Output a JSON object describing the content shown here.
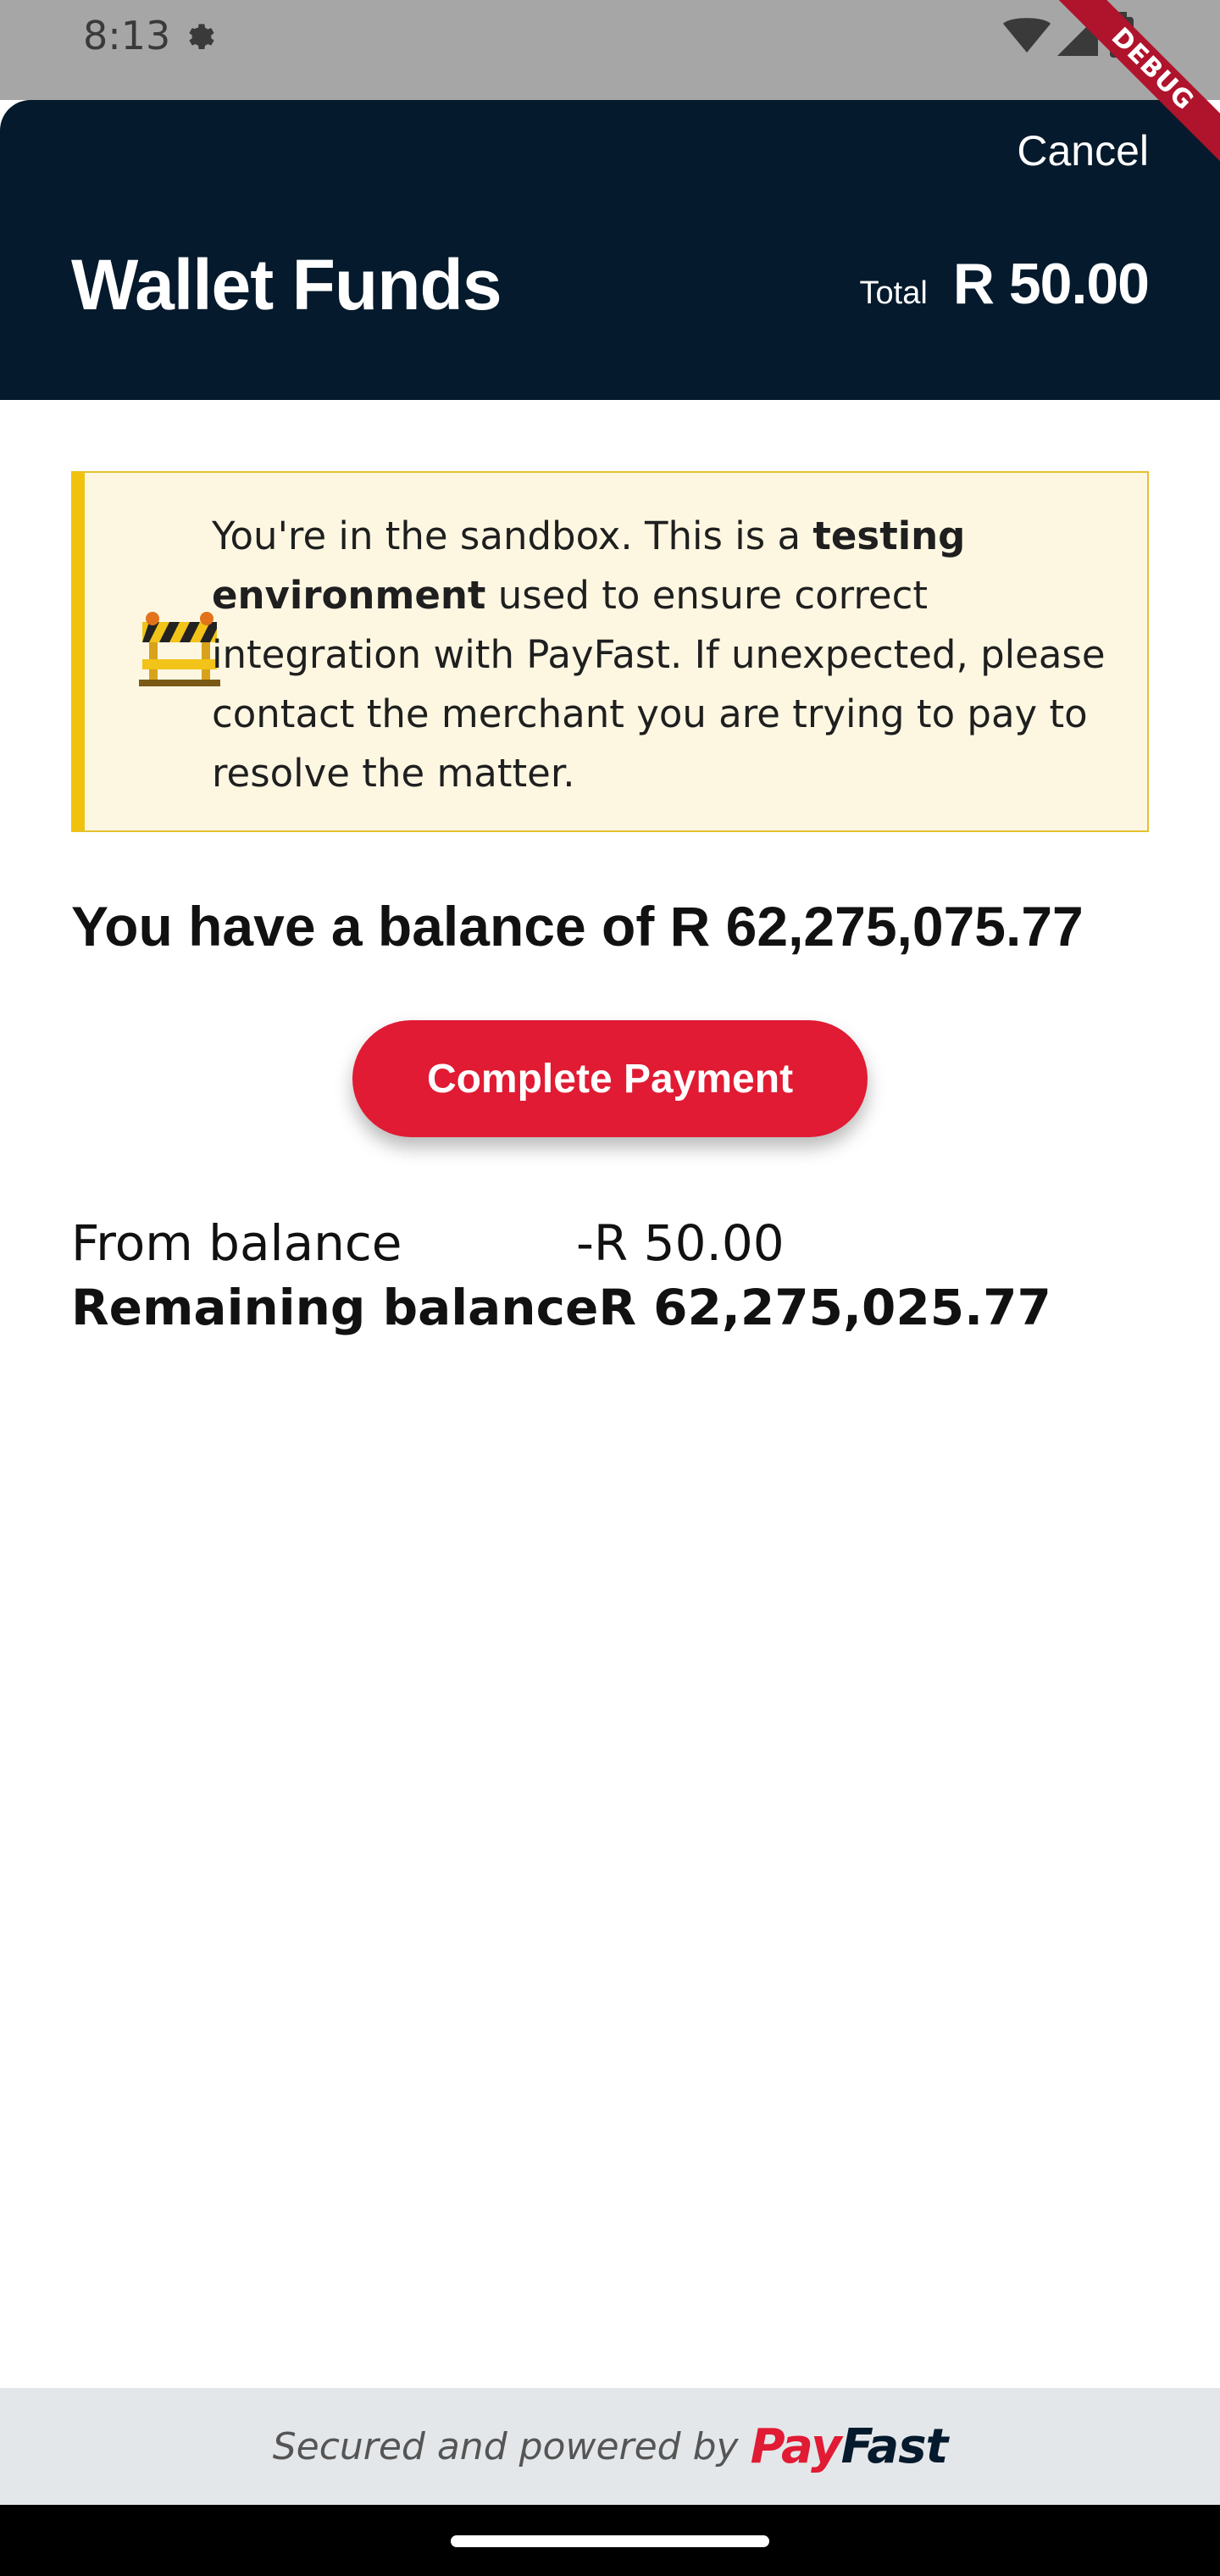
{
  "status_bar": {
    "time": "8:13",
    "icons": [
      "gear-icon",
      "wifi-icon",
      "cellular-signal-icon",
      "battery-icon"
    ]
  },
  "debug_banner": {
    "label": "DEBUG"
  },
  "header": {
    "cancel_label": "Cancel",
    "title": "Wallet Funds",
    "total_label": "Total",
    "total_value": "R 50.00"
  },
  "sandbox_notice": {
    "icon": "construction-barrier-icon",
    "text_before": "You're in the sandbox. This is a ",
    "text_bold": "testing environment",
    "text_after": " used to ensure correct integration with PayFast. If unexpected, please contact the merchant you are trying to pay to resolve the matter."
  },
  "balance": {
    "heading": "You have a balance of R 62,275,075.77"
  },
  "pay_button": {
    "label": "Complete Payment"
  },
  "breakdown": {
    "from_label": "From balance",
    "from_value": "-R 50.00",
    "remaining_label": "Remaining balance",
    "remaining_value": "R 62,275,025.77"
  },
  "footer": {
    "text": "Secured and powered by",
    "logo_part1": "Pay",
    "logo_part2": "Fast"
  },
  "colors": {
    "header_bg": "#051a2c",
    "accent_red": "#e01b33",
    "notice_bg": "#fdf7e2",
    "notice_border": "#f0c20e",
    "footer_bg": "#e4e7ea"
  }
}
